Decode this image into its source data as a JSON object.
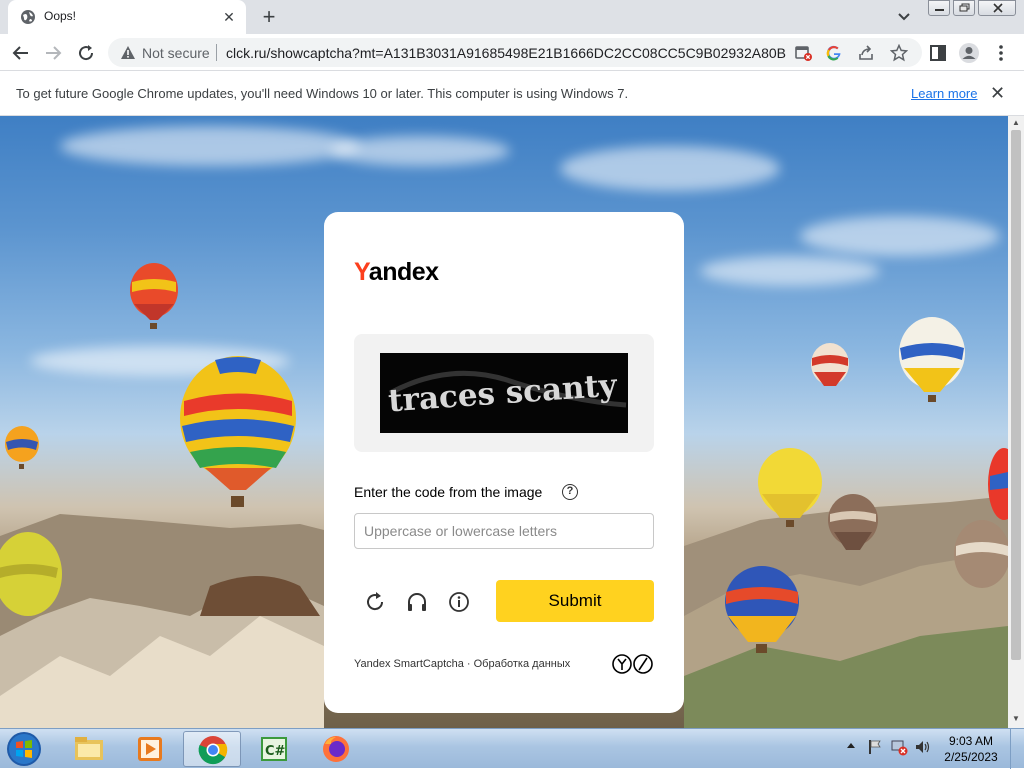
{
  "browser": {
    "tab": {
      "title": "Oops!"
    },
    "address": {
      "security_label": "Not secure",
      "url": "clck.ru/showcaptcha?mt=A131B3031A91685498E21B1666DC2CC08CC5C9B02932A80B6..."
    },
    "infobar": {
      "message": "To get future Google Chrome updates, you'll need Windows 10 or later. This computer is using Windows 7.",
      "link": "Learn more"
    }
  },
  "captcha": {
    "logo_first": "Y",
    "logo_rest": "andex",
    "image_text": "traces scanty",
    "prompt": "Enter the code from the image",
    "help_glyph": "?",
    "input": {
      "placeholder": "Uppercase or lowercase letters",
      "value": ""
    },
    "submit_label": "Submit",
    "footer": "Yandex SmartCaptcha · Обработка данных"
  },
  "taskbar": {
    "apps": [
      "explorer",
      "media-player",
      "chrome",
      "csharp",
      "firefox"
    ],
    "active_app": "chrome",
    "clock": {
      "time": "9:03 AM",
      "date": "2/25/2023"
    }
  },
  "colors": {
    "yandex_red": "#fc3f1d",
    "submit_yellow": "#ffd21f",
    "link_blue": "#1a73e8"
  }
}
